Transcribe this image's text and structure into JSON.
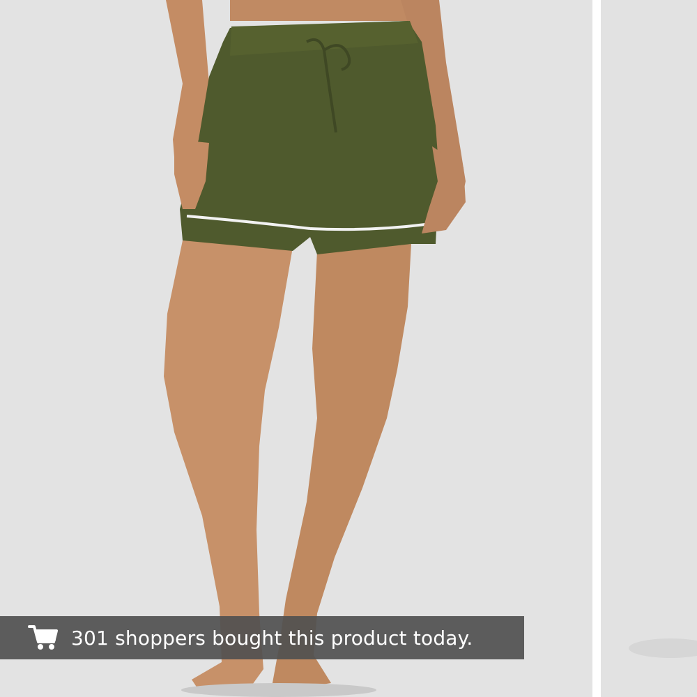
{
  "product_gallery": {
    "main_image_alt": "Olive green drawstring shorts with white piping",
    "product_color": "#4f5a2d",
    "background_color": "#e3e3e3"
  },
  "social_proof": {
    "icon": "shopping-cart-icon",
    "text": "301 shoppers bought this product today."
  }
}
